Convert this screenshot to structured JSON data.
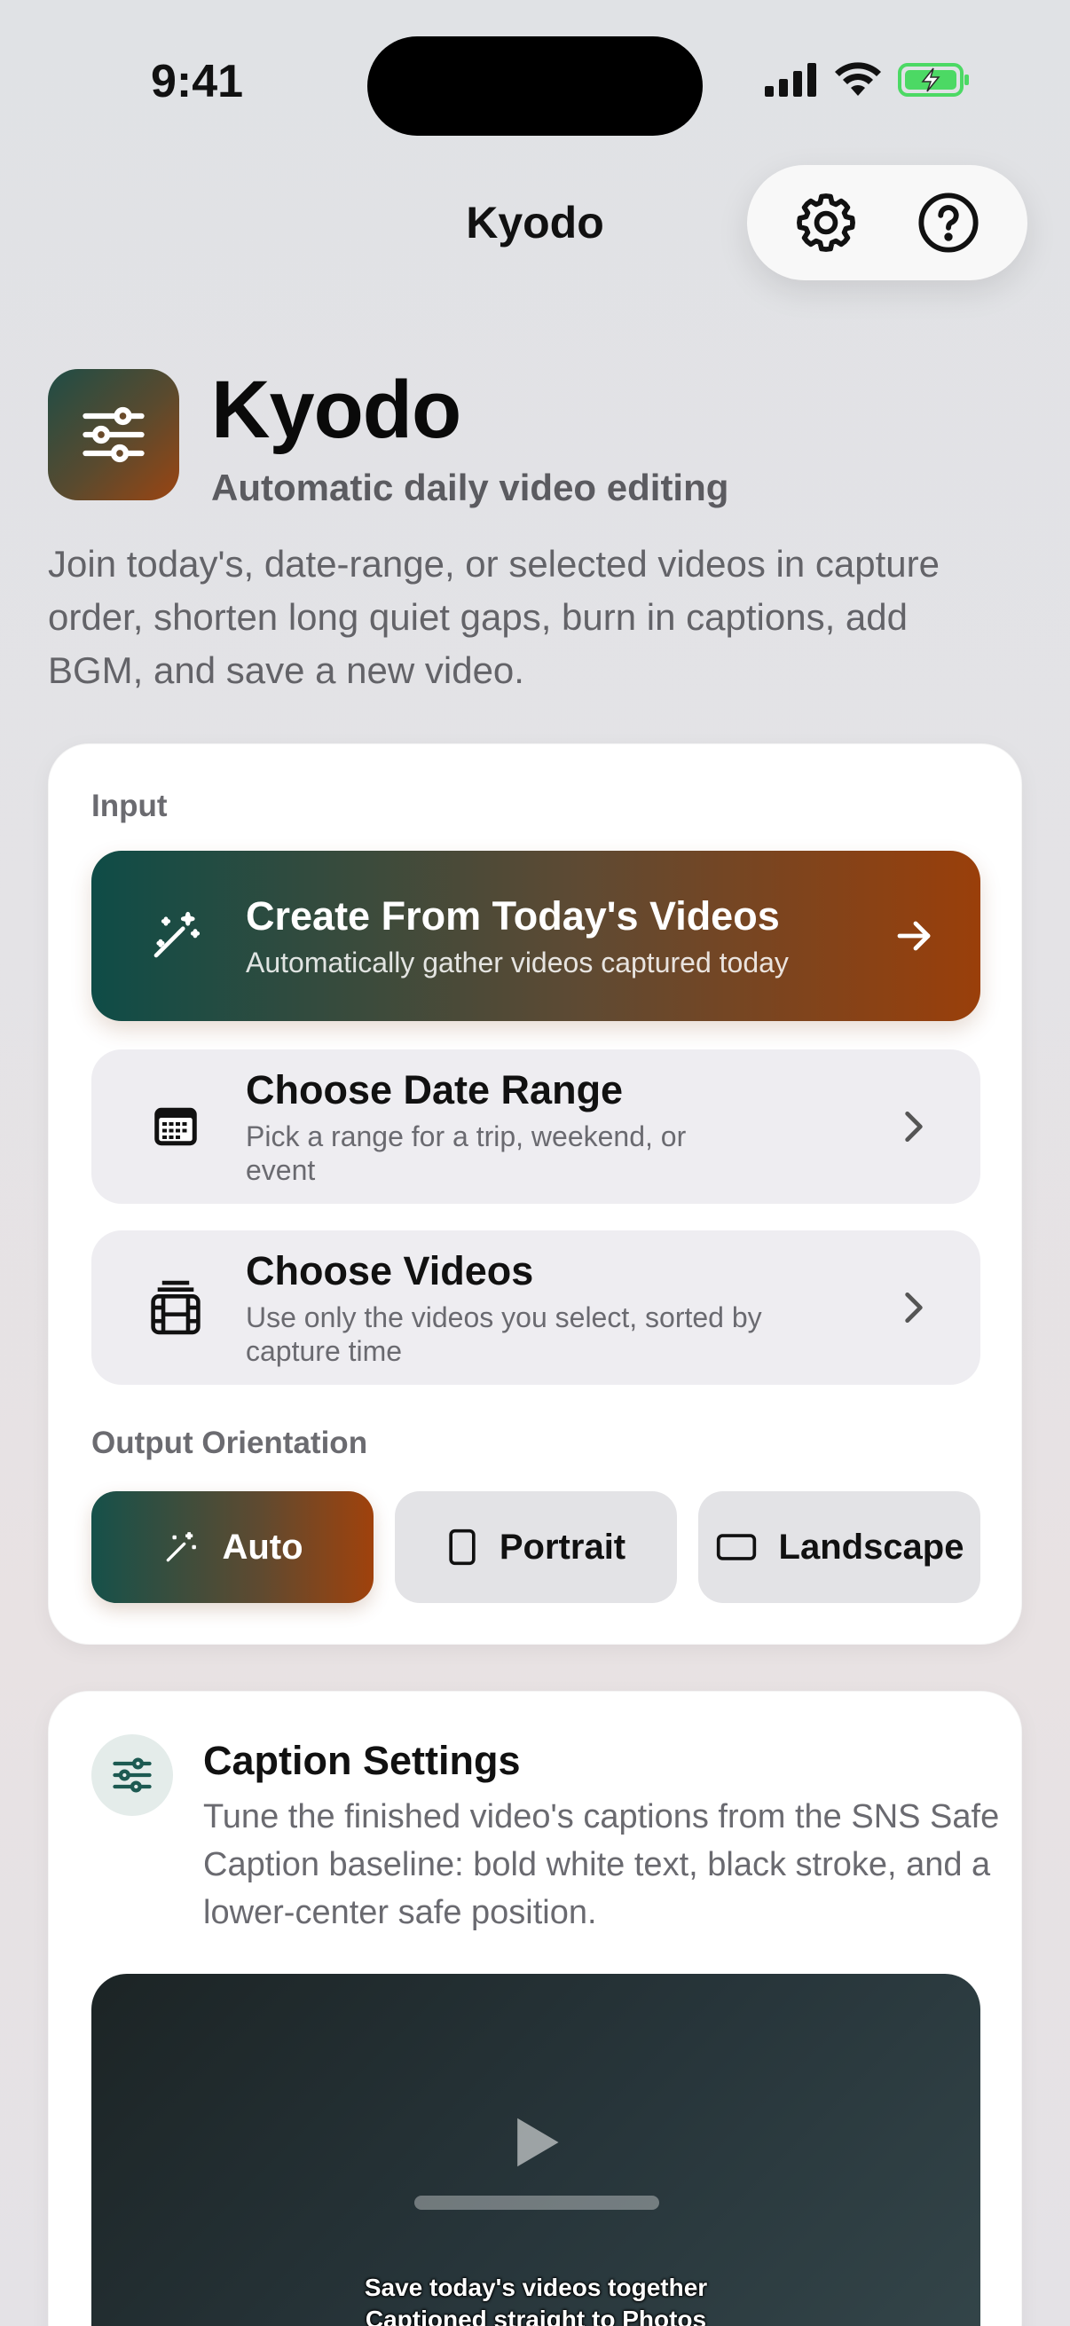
{
  "status_bar": {
    "time": "9:41"
  },
  "nav": {
    "title": "Kyodo"
  },
  "hero": {
    "title": "Kyodo",
    "subtitle": "Automatic daily video editing",
    "description": "Join today's, date-range, or selected videos in capture order, shorten long quiet gaps, burn in captions, add BGM, and save a new video."
  },
  "input_section": {
    "label": "Input",
    "rows": [
      {
        "title": "Create From Today's Videos",
        "desc": "Automatically gather videos captured today"
      },
      {
        "title": "Choose Date Range",
        "desc": "Pick a range for a trip, weekend, or event"
      },
      {
        "title": "Choose Videos",
        "desc": "Use only the videos you select, sorted by capture time"
      }
    ]
  },
  "orientation": {
    "label": "Output Orientation",
    "options": [
      "Auto",
      "Portrait",
      "Landscape"
    ],
    "selected": "Auto"
  },
  "caption_settings": {
    "title": "Caption Settings",
    "description": "Tune the finished video's captions from the SNS Safe Caption baseline: bold white text, black stroke, and a lower-center safe position.",
    "preview_lines": [
      "Save today's videos together",
      "Captioned straight to Photos"
    ]
  },
  "colors": {
    "accent_teal": "#0f4c47",
    "accent_orange": "#9a3f0a",
    "battery_green": "#4cd964"
  }
}
